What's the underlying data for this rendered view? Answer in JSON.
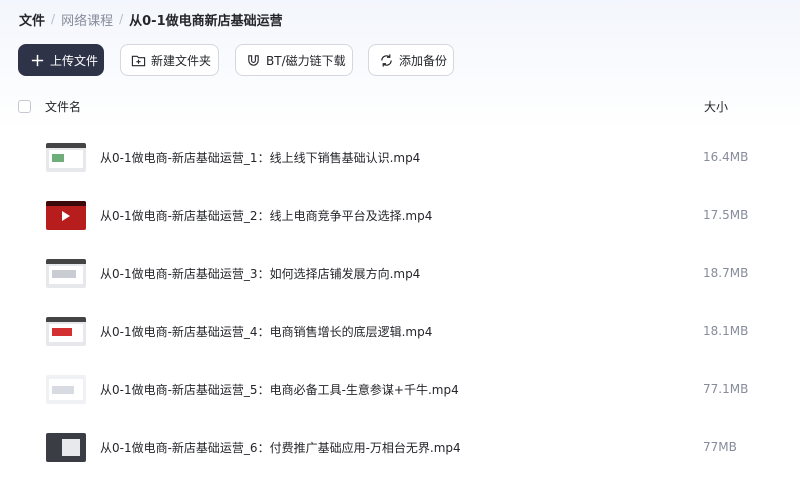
{
  "breadcrumb": [
    "文件",
    "网络课程",
    "从0-1做电商新店基础运营"
  ],
  "toolbar": {
    "upload": "上传文件",
    "new_folder": "新建文件夹",
    "bt": "BT/磁力链下载",
    "backup": "添加备份"
  },
  "table": {
    "col_name": "文件名",
    "col_size": "大小"
  },
  "files": [
    {
      "name": "从0-1做电商-新店基础运营_1：线上线下销售基础认识.mp4",
      "size": "16.4MB",
      "thumb": "green"
    },
    {
      "name": "从0-1做电商-新店基础运营_2：线上电商竞争平台及选择.mp4",
      "size": "17.5MB",
      "thumb": "red-play"
    },
    {
      "name": "从0-1做电商-新店基础运营_3：如何选择店铺发展方向.mp4",
      "size": "18.7MB",
      "thumb": "gray"
    },
    {
      "name": "从0-1做电商-新店基础运营_4：电商销售增长的底层逻辑.mp4",
      "size": "18.1MB",
      "thumb": "red"
    },
    {
      "name": "从0-1做电商-新店基础运营_5：电商必备工具-生意参谋+千牛.mp4",
      "size": "77.1MB",
      "thumb": "light"
    },
    {
      "name": "从0-1做电商-新店基础运营_6：付费推广基础应用-万相台无界.mp4",
      "size": "77MB",
      "thumb": "dark"
    }
  ],
  "icons": {
    "upload": "plus-icon",
    "new_folder": "folder-plus-icon",
    "bt": "magnet-icon",
    "backup": "sync-icon"
  }
}
